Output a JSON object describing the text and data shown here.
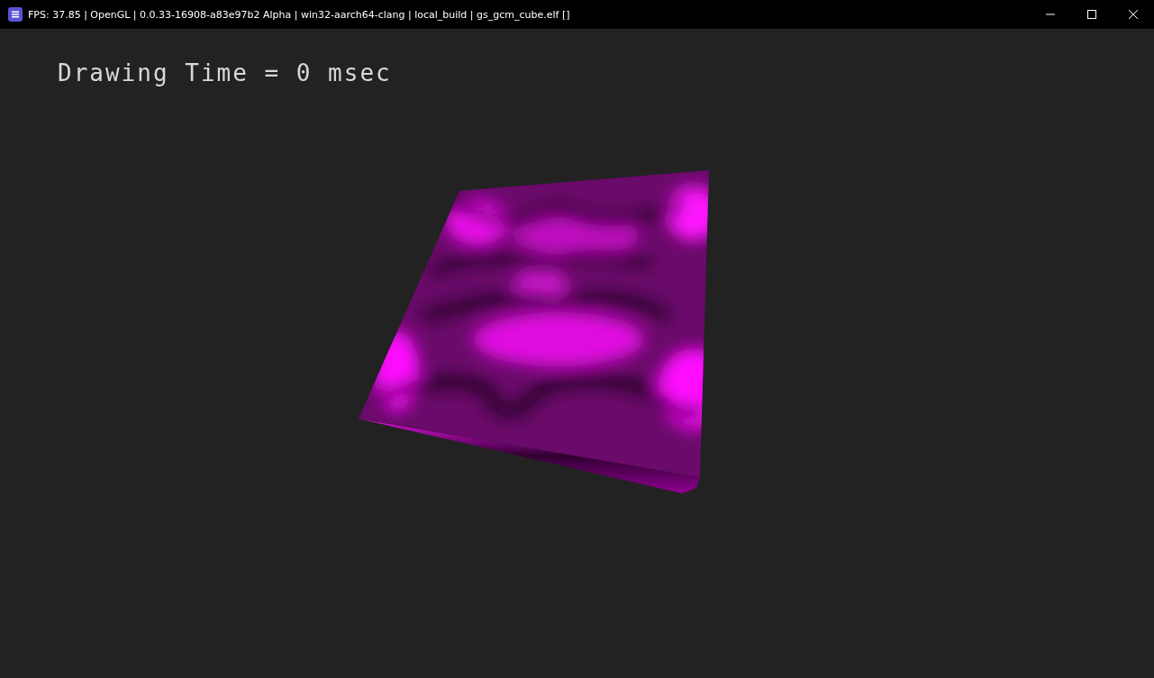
{
  "window": {
    "title": "FPS: 37.85 | OpenGL | 0.0.33-16908-a83e97b2 Alpha | win32-aarch64-clang | local_build | gs_gcm_cube.elf []"
  },
  "viewport": {
    "overlay_text": "Drawing Time = 0 msec"
  }
}
